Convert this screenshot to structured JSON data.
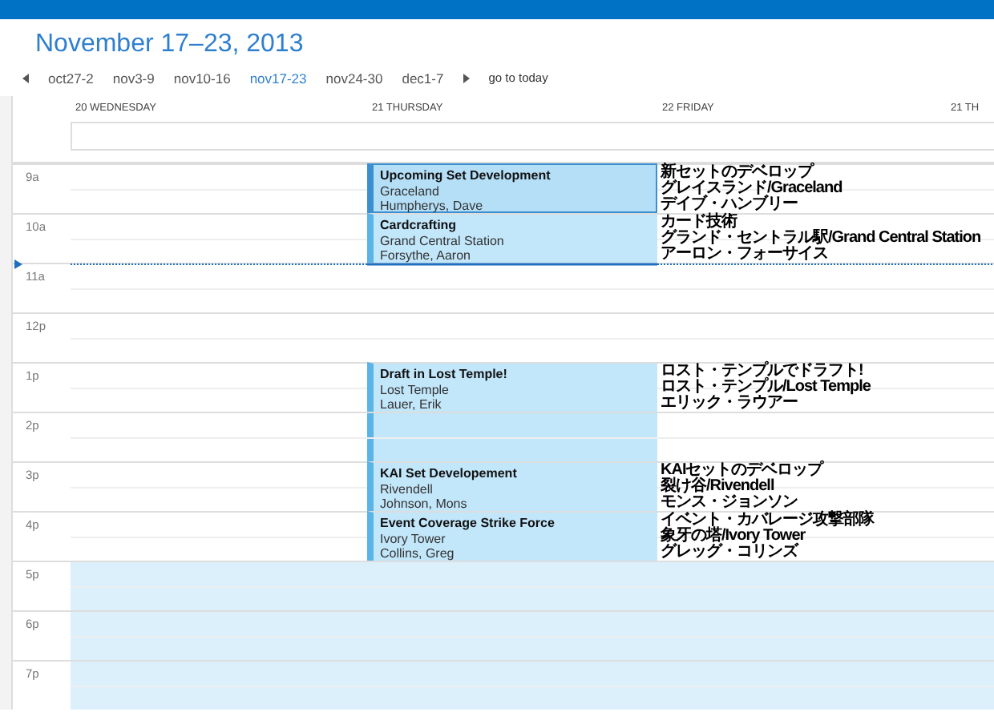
{
  "title": "November 17–23, 2013",
  "week_nav": {
    "weeks": [
      {
        "label": "oct27-2",
        "selected": false
      },
      {
        "label": "nov3-9",
        "selected": false
      },
      {
        "label": "nov10-16",
        "selected": false
      },
      {
        "label": "nov17-23",
        "selected": true
      },
      {
        "label": "nov24-30",
        "selected": false
      },
      {
        "label": "dec1-7",
        "selected": false
      }
    ],
    "go_to_today": "go to today"
  },
  "days": [
    {
      "label": "20 WEDNESDAY"
    },
    {
      "label": "21 THURSDAY"
    },
    {
      "label": "22 FRIDAY"
    },
    {
      "label": "21 TH"
    }
  ],
  "hours": [
    {
      "label": "9a",
      "off_hours": false,
      "current": false,
      "event": {
        "kind": "one-hour",
        "selected": true,
        "title": "Upcoming Set Development",
        "location": "Graceland",
        "organizer": "Humpherys, Dave",
        "translation": [
          "新セットのデベロップ",
          "グレイスランド/Graceland",
          "デイブ・ハンブリー"
        ]
      }
    },
    {
      "label": "10a",
      "off_hours": false,
      "current": false,
      "event": {
        "kind": "one-hour",
        "selected": false,
        "title": "Cardcrafting",
        "location": "Grand Central Station",
        "organizer": "Forsythe, Aaron",
        "translation": [
          "カード技術",
          "グランド・セントラル駅/Grand Central Station",
          "アーロン・フォーサイス"
        ]
      }
    },
    {
      "label": "11a",
      "off_hours": false,
      "current": true
    },
    {
      "label": "12p",
      "off_hours": false,
      "current": false
    },
    {
      "label": "1p",
      "off_hours": false,
      "current": false,
      "event": {
        "kind": "two-hour",
        "selected": false,
        "title": "Draft in Lost Temple!",
        "location": "Lost Temple",
        "organizer": "Lauer, Erik",
        "translation": [
          "ロスト・テンプルでドラフト!",
          "ロスト・テンプル/Lost Temple",
          "エリック・ラウアー"
        ]
      }
    },
    {
      "label": "2p",
      "off_hours": false,
      "current": false
    },
    {
      "label": "3p",
      "off_hours": false,
      "current": false,
      "event": {
        "kind": "one-hour",
        "selected": false,
        "title": "KAI Set Developement",
        "location": "Rivendell",
        "organizer": "Johnson, Mons",
        "translation": [
          "KAIセットのデベロップ",
          "裂け谷/Rivendell",
          "モンス・ジョンソン"
        ]
      }
    },
    {
      "label": "4p",
      "off_hours": false,
      "current": false,
      "event": {
        "kind": "one-hour",
        "selected": false,
        "title": "Event Coverage Strike Force",
        "location": "Ivory Tower",
        "organizer": "Collins, Greg",
        "translation": [
          "イベント・カバレージ攻撃部隊",
          "象牙の塔/Ivory Tower",
          "グレッグ・コリンズ"
        ]
      }
    },
    {
      "label": "5p",
      "off_hours": true,
      "current": false
    },
    {
      "label": "6p",
      "off_hours": true,
      "current": false
    },
    {
      "label": "7p",
      "off_hours": true,
      "current": false
    }
  ]
}
